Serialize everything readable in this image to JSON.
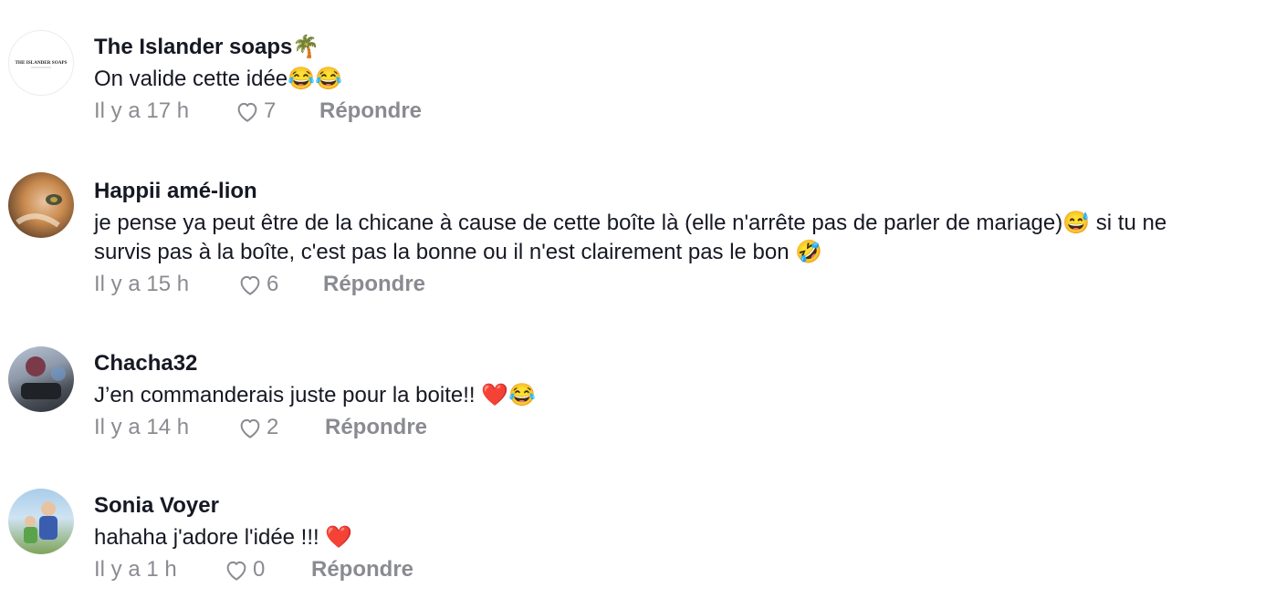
{
  "comments": [
    {
      "author": "The Islander soaps🌴",
      "text": "On valide cette idée😂😂",
      "time": "Il y a 17 h",
      "likes": "7",
      "reply": "Répondre",
      "avatar_logo": "THE ISLANDER SOAPS"
    },
    {
      "author": "Happii amé-lion",
      "text_line1": "je pense ya peut être de la chicane à cause de cette boîte là (elle n'arrête pas de parler de mariage)😅 si tu ne",
      "text_line2": "survis pas à la boîte, c'est pas la bonne ou il n'est clairement pas le bon 🤣",
      "time": "Il y a 15 h",
      "likes": "6",
      "reply": "Répondre"
    },
    {
      "author": "Chacha32",
      "text": "J’en commanderais juste pour la boite!! ❤️😂",
      "time": "Il y a 14 h",
      "likes": "2",
      "reply": "Répondre"
    },
    {
      "author": "Sonia Voyer",
      "text": "hahaha j'adore l'idée !!! ❤️",
      "time": "Il y a 1 h",
      "likes": "0",
      "reply": "Répondre"
    }
  ],
  "icons": {
    "like": "heart-outline-icon"
  },
  "colors": {
    "text": "#161823",
    "muted": "#8a8b91",
    "background": "#ffffff"
  }
}
